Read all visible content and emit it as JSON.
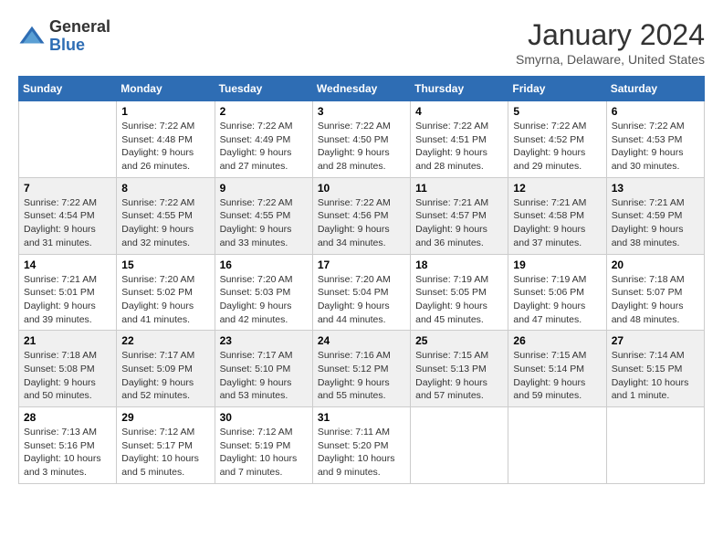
{
  "logo": {
    "general": "General",
    "blue": "Blue"
  },
  "title": {
    "month": "January 2024",
    "location": "Smyrna, Delaware, United States"
  },
  "weekdays": [
    "Sunday",
    "Monday",
    "Tuesday",
    "Wednesday",
    "Thursday",
    "Friday",
    "Saturday"
  ],
  "weeks": [
    [
      {
        "day": "",
        "info": ""
      },
      {
        "day": "1",
        "info": "Sunrise: 7:22 AM\nSunset: 4:48 PM\nDaylight: 9 hours\nand 26 minutes."
      },
      {
        "day": "2",
        "info": "Sunrise: 7:22 AM\nSunset: 4:49 PM\nDaylight: 9 hours\nand 27 minutes."
      },
      {
        "day": "3",
        "info": "Sunrise: 7:22 AM\nSunset: 4:50 PM\nDaylight: 9 hours\nand 28 minutes."
      },
      {
        "day": "4",
        "info": "Sunrise: 7:22 AM\nSunset: 4:51 PM\nDaylight: 9 hours\nand 28 minutes."
      },
      {
        "day": "5",
        "info": "Sunrise: 7:22 AM\nSunset: 4:52 PM\nDaylight: 9 hours\nand 29 minutes."
      },
      {
        "day": "6",
        "info": "Sunrise: 7:22 AM\nSunset: 4:53 PM\nDaylight: 9 hours\nand 30 minutes."
      }
    ],
    [
      {
        "day": "7",
        "info": "Sunrise: 7:22 AM\nSunset: 4:54 PM\nDaylight: 9 hours\nand 31 minutes."
      },
      {
        "day": "8",
        "info": "Sunrise: 7:22 AM\nSunset: 4:55 PM\nDaylight: 9 hours\nand 32 minutes."
      },
      {
        "day": "9",
        "info": "Sunrise: 7:22 AM\nSunset: 4:55 PM\nDaylight: 9 hours\nand 33 minutes."
      },
      {
        "day": "10",
        "info": "Sunrise: 7:22 AM\nSunset: 4:56 PM\nDaylight: 9 hours\nand 34 minutes."
      },
      {
        "day": "11",
        "info": "Sunrise: 7:21 AM\nSunset: 4:57 PM\nDaylight: 9 hours\nand 36 minutes."
      },
      {
        "day": "12",
        "info": "Sunrise: 7:21 AM\nSunset: 4:58 PM\nDaylight: 9 hours\nand 37 minutes."
      },
      {
        "day": "13",
        "info": "Sunrise: 7:21 AM\nSunset: 4:59 PM\nDaylight: 9 hours\nand 38 minutes."
      }
    ],
    [
      {
        "day": "14",
        "info": "Sunrise: 7:21 AM\nSunset: 5:01 PM\nDaylight: 9 hours\nand 39 minutes."
      },
      {
        "day": "15",
        "info": "Sunrise: 7:20 AM\nSunset: 5:02 PM\nDaylight: 9 hours\nand 41 minutes."
      },
      {
        "day": "16",
        "info": "Sunrise: 7:20 AM\nSunset: 5:03 PM\nDaylight: 9 hours\nand 42 minutes."
      },
      {
        "day": "17",
        "info": "Sunrise: 7:20 AM\nSunset: 5:04 PM\nDaylight: 9 hours\nand 44 minutes."
      },
      {
        "day": "18",
        "info": "Sunrise: 7:19 AM\nSunset: 5:05 PM\nDaylight: 9 hours\nand 45 minutes."
      },
      {
        "day": "19",
        "info": "Sunrise: 7:19 AM\nSunset: 5:06 PM\nDaylight: 9 hours\nand 47 minutes."
      },
      {
        "day": "20",
        "info": "Sunrise: 7:18 AM\nSunset: 5:07 PM\nDaylight: 9 hours\nand 48 minutes."
      }
    ],
    [
      {
        "day": "21",
        "info": "Sunrise: 7:18 AM\nSunset: 5:08 PM\nDaylight: 9 hours\nand 50 minutes."
      },
      {
        "day": "22",
        "info": "Sunrise: 7:17 AM\nSunset: 5:09 PM\nDaylight: 9 hours\nand 52 minutes."
      },
      {
        "day": "23",
        "info": "Sunrise: 7:17 AM\nSunset: 5:10 PM\nDaylight: 9 hours\nand 53 minutes."
      },
      {
        "day": "24",
        "info": "Sunrise: 7:16 AM\nSunset: 5:12 PM\nDaylight: 9 hours\nand 55 minutes."
      },
      {
        "day": "25",
        "info": "Sunrise: 7:15 AM\nSunset: 5:13 PM\nDaylight: 9 hours\nand 57 minutes."
      },
      {
        "day": "26",
        "info": "Sunrise: 7:15 AM\nSunset: 5:14 PM\nDaylight: 9 hours\nand 59 minutes."
      },
      {
        "day": "27",
        "info": "Sunrise: 7:14 AM\nSunset: 5:15 PM\nDaylight: 10 hours\nand 1 minute."
      }
    ],
    [
      {
        "day": "28",
        "info": "Sunrise: 7:13 AM\nSunset: 5:16 PM\nDaylight: 10 hours\nand 3 minutes."
      },
      {
        "day": "29",
        "info": "Sunrise: 7:12 AM\nSunset: 5:17 PM\nDaylight: 10 hours\nand 5 minutes."
      },
      {
        "day": "30",
        "info": "Sunrise: 7:12 AM\nSunset: 5:19 PM\nDaylight: 10 hours\nand 7 minutes."
      },
      {
        "day": "31",
        "info": "Sunrise: 7:11 AM\nSunset: 5:20 PM\nDaylight: 10 hours\nand 9 minutes."
      },
      {
        "day": "",
        "info": ""
      },
      {
        "day": "",
        "info": ""
      },
      {
        "day": "",
        "info": ""
      }
    ]
  ]
}
